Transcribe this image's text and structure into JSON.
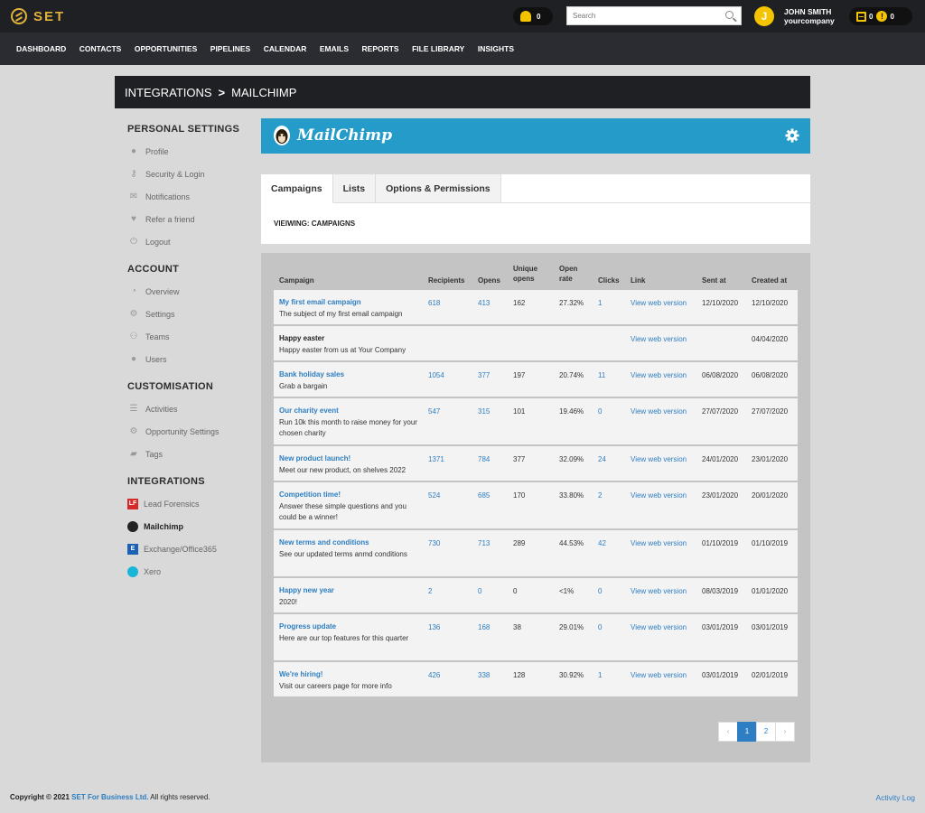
{
  "app": {
    "logo": "SET",
    "notification_count": "0",
    "calendar_count": "0",
    "warning_count": "0"
  },
  "search": {
    "placeholder": "Search"
  },
  "user": {
    "avatar_initial": "J",
    "name": "JOHN SMITH",
    "company": "yourcompany"
  },
  "nav": [
    "DASHBOARD",
    "CONTACTS",
    "OPPORTUNITIES",
    "PIPELINES",
    "CALENDAR",
    "EMAILS",
    "REPORTS",
    "FILE LIBRARY",
    "INSIGHTS"
  ],
  "breadcrumb": {
    "parent": "INTEGRATIONS",
    "separator": ">",
    "current": "MAILCHIMP"
  },
  "sidebar": {
    "personal": {
      "heading": "PERSONAL SETTINGS",
      "items": [
        "Profile",
        "Security & Login",
        "Notifications",
        "Refer a friend",
        "Logout"
      ]
    },
    "account": {
      "heading": "ACCOUNT",
      "items": [
        "Overview",
        "Settings",
        "Teams",
        "Users"
      ]
    },
    "custom": {
      "heading": "CUSTOMISATION",
      "items": [
        "Activities",
        "Opportunity Settings",
        "Tags"
      ]
    },
    "integrations": {
      "heading": "INTEGRATIONS",
      "items": [
        "Lead Forensics",
        "Mailchimp",
        "Exchange/Office365",
        "Xero"
      ],
      "active": "Mailchimp",
      "lf_icon_text": "LF",
      "exchange_icon_text": "E"
    }
  },
  "banner": {
    "title": "MailChimp",
    "brand_color": "#249bc8"
  },
  "tabs": [
    "Campaigns",
    "Lists",
    "Options & Permissions"
  ],
  "viewing_label": "VIEIWING: CAMPAIGNS",
  "table": {
    "headers": {
      "campaign": "Campaign",
      "recipients": "Recipients",
      "opens": "Opens",
      "unique_1": "Unique",
      "unique_2": "opens",
      "rate_1": "Open",
      "rate_2": "rate",
      "clicks": "Clicks",
      "link": "Link",
      "sent": "Sent at",
      "created": "Created at"
    },
    "rows": [
      {
        "name": "My first email campaign",
        "desc": "The subject of my first email campaign",
        "recipients": "618",
        "opens": "413",
        "unique": "162",
        "rate": "27.32%",
        "clicks": "1",
        "link": "View web version",
        "sent": "12/10/2020",
        "created": "12/10/2020"
      },
      {
        "name": "Happy easter",
        "desc": "Happy easter from us at Your Company",
        "recipients": "",
        "opens": "",
        "unique": "",
        "rate": "",
        "clicks": "",
        "link": "View web version",
        "sent": "",
        "created": "04/04/2020"
      },
      {
        "name": "Bank holiday sales",
        "desc": "Grab a bargain",
        "recipients": "1054",
        "opens": "377",
        "unique": "197",
        "rate": "20.74%",
        "clicks": "11",
        "link": "View web version",
        "sent": "06/08/2020",
        "created": "06/08/2020"
      },
      {
        "name": "Our charity event",
        "desc": "Run 10k this month to raise money for your chosen charity",
        "recipients": "547",
        "opens": "315",
        "unique": "101",
        "rate": "19.46%",
        "clicks": "0",
        "link": "View web version",
        "sent": "27/07/2020",
        "created": "27/07/2020"
      },
      {
        "name": "New product launch!",
        "desc": "Meet our new product, on shelves 2022",
        "recipients": "1371",
        "opens": "784",
        "unique": "377",
        "rate": "32.09%",
        "clicks": "24",
        "link": "View web version",
        "sent": "24/01/2020",
        "created": "23/01/2020"
      },
      {
        "name": "Competition time!",
        "desc": "Answer these simple questions and you could be a winner!",
        "recipients": "524",
        "opens": "685",
        "unique": "170",
        "rate": "33.80%",
        "clicks": "2",
        "link": "View web version",
        "sent": "23/01/2020",
        "created": "20/01/2020"
      },
      {
        "name": "New terms and conditions",
        "desc": "See our updated terms anmd conditions",
        "recipients": "730",
        "opens": "713",
        "unique": "289",
        "rate": "44.53%",
        "clicks": "42",
        "link": "View web version",
        "sent": "01/10/2019",
        "created": "01/10/2019"
      },
      {
        "name": "Happy new year",
        "desc": "2020!",
        "recipients": "2",
        "opens": "0",
        "unique": "0",
        "rate": "<1%",
        "clicks": "0",
        "link": "View web version",
        "sent": "08/03/2019",
        "created": "01/01/2020"
      },
      {
        "name": "Progress update",
        "desc": "Here are our top features for this quarter",
        "recipients": "136",
        "opens": "168",
        "unique": "38",
        "rate": "29.01%",
        "clicks": "0",
        "link": "View web version",
        "sent": "03/01/2019",
        "created": "03/01/2019"
      },
      {
        "name": "We're hiring!",
        "desc": "Visit our careers page for more info",
        "recipients": "426",
        "opens": "338",
        "unique": "128",
        "rate": "30.92%",
        "clicks": "1",
        "link": "View web version",
        "sent": "03/01/2019",
        "created": "02/01/2019"
      }
    ]
  },
  "pagination": {
    "prev": "‹",
    "pages": [
      "1",
      "2"
    ],
    "current": "1",
    "next": "›"
  },
  "footer": {
    "prefix": "Copyright © 2021",
    "company": "SET For Business Ltd.",
    "suffix": "All rights reserved.",
    "activity_log": "Activity Log"
  },
  "colors": {
    "accent": "#2d7ec2",
    "topbar": "#1f2024",
    "gold": "#e2b23c"
  }
}
